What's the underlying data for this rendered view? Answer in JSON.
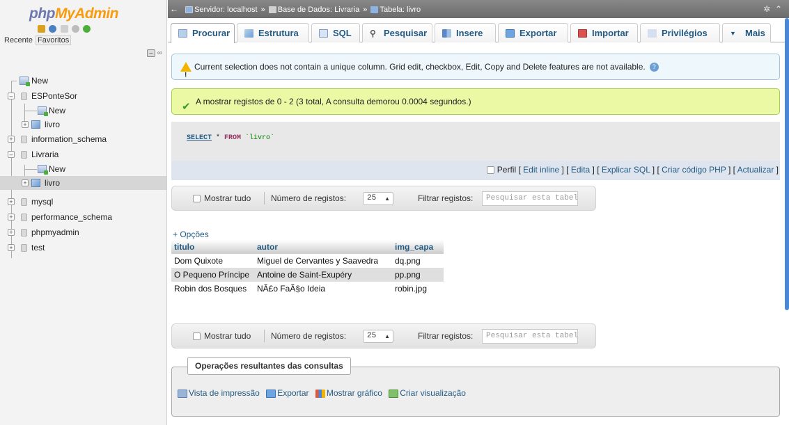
{
  "logo": {
    "part1": "php",
    "part2": "MyAdmin"
  },
  "nav": {
    "tabs": [
      "Recente",
      "Favoritos"
    ],
    "tree": [
      {
        "label": "New",
        "type": "new",
        "level": 0
      },
      {
        "label": "ESPonteSor",
        "type": "db",
        "level": 0,
        "expanded": true
      },
      {
        "label": "New",
        "type": "new",
        "level": 1
      },
      {
        "label": "livro",
        "type": "table",
        "level": 1
      },
      {
        "label": "information_schema",
        "type": "db",
        "level": 0
      },
      {
        "label": "Livraria",
        "type": "db",
        "level": 0,
        "expanded": true
      },
      {
        "label": "New",
        "type": "new",
        "level": 1
      },
      {
        "label": "livro",
        "type": "table",
        "level": 1,
        "selected": true
      },
      {
        "label": "mysql",
        "type": "db",
        "level": 0
      },
      {
        "label": "performance_schema",
        "type": "db",
        "level": 0
      },
      {
        "label": "phpmyadmin",
        "type": "db",
        "level": 0
      },
      {
        "label": "test",
        "type": "db",
        "level": 0
      }
    ]
  },
  "breadcrumb": {
    "server": "Servidor: localhost",
    "database": "Base de Dados: Livraria",
    "table": "Tabela: livro",
    "sep": "»"
  },
  "tabs": [
    "Procurar",
    "Estrutura",
    "SQL",
    "Pesquisar",
    "Insere",
    "Exportar",
    "Importar",
    "Privilégios",
    "Mais"
  ],
  "notices": {
    "warning": "Current selection does not contain a unique column. Grid edit, checkbox, Edit, Copy and Delete features are not available.",
    "success": "A mostrar registos de 0 - 2 (3 total, A consulta demorou 0.0004 segundos.)"
  },
  "sql": {
    "select": "SELECT",
    "rest": " * ",
    "from": "FROM",
    "table": " `livro`"
  },
  "sql_links": {
    "perfil": "Perfil",
    "edit_inline": "Edit inline",
    "edita": "Edita",
    "explicar": "Explicar SQL",
    "criar_php": "Criar código PHP",
    "actualizar": "Actualizar"
  },
  "navbar": {
    "mostrar_tudo": "Mostrar tudo",
    "num_label": "Número de registos:",
    "num_value": "25",
    "filter_label": "Filtrar registos:",
    "filter_placeholder": "Pesquisar esta tabela"
  },
  "results": {
    "opcoes": "+ Opções",
    "columns": [
      "titulo",
      "autor",
      "img_capa"
    ],
    "rows": [
      [
        "Dom Quixote",
        "Miguel de Cervantes y Saavedra",
        "dq.png"
      ],
      [
        "O Pequeno Príncipe",
        "Antoine de Saint-Exupéry",
        "pp.png"
      ],
      [
        "Robin dos Bosques",
        "NÃ£o FaÃ§o Ideia",
        "robin.jpg"
      ]
    ]
  },
  "operations": {
    "legend": "Operações resultantes das consultas",
    "links": [
      "Vista de impressão",
      "Exportar",
      "Mostrar gráfico",
      "Criar visualização"
    ]
  },
  "colors": {
    "accent": "#235a81",
    "success_bg": "#ebf8a4",
    "notice_bg": "#eef7fb"
  }
}
